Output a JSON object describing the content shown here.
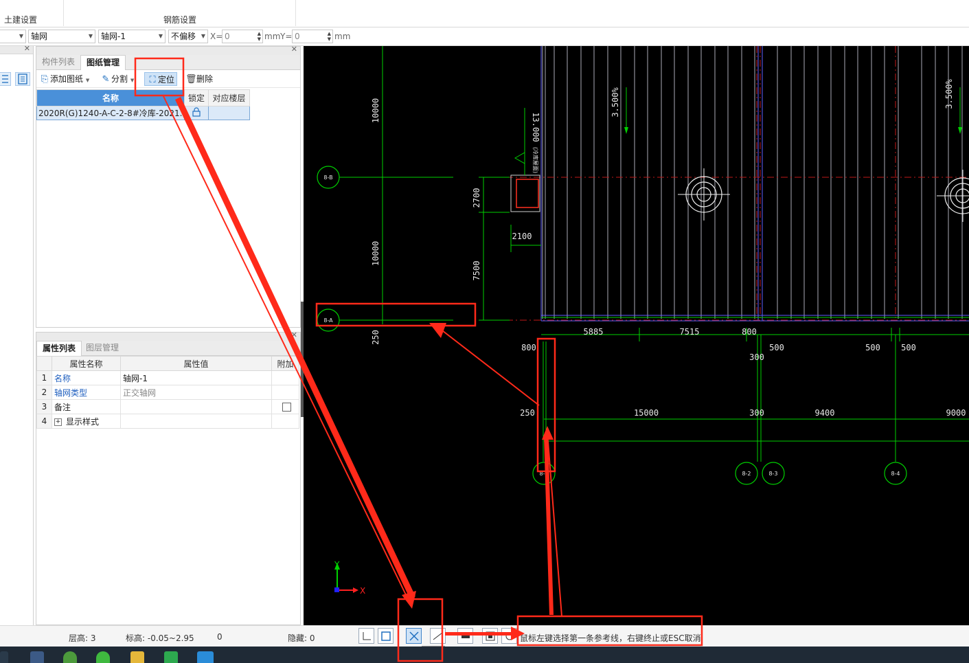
{
  "ribbon": {
    "group_civil": "土建设置",
    "group_rebar": "钢筋设置"
  },
  "toolbar": {
    "combo_axis_type": "轴网",
    "combo_axis_name": "轴网-1",
    "combo_offset": "不偏移",
    "x_label": "X=",
    "x_value": "0",
    "mm_label_1": "mm",
    "y_label": "Y=",
    "y_value": "0",
    "mm_label_2": "mm"
  },
  "drawing_panel": {
    "tabs": [
      "构件列表",
      "图纸管理"
    ],
    "tools": {
      "add": "添加图纸",
      "split": "分割",
      "locate": "定位",
      "delete": "删除"
    },
    "columns": [
      "名称",
      "锁定",
      "对应楼层"
    ],
    "rows": [
      {
        "name": "2020R(G)1240-A-C-2-8#冷库-2021...",
        "lock_icon": "lock-icon",
        "floor": ""
      }
    ]
  },
  "property_panel": {
    "tabs": [
      "属性列表",
      "图层管理"
    ],
    "columns": [
      "属性名称",
      "属性值",
      "附加"
    ],
    "rows": [
      {
        "n": "1",
        "name": "名称",
        "value": "轴网-1",
        "has_check": false
      },
      {
        "n": "2",
        "name": "轴网类型",
        "value": "正交轴网",
        "has_check": false
      },
      {
        "n": "3",
        "name": "备注",
        "value": "",
        "has_check": true
      },
      {
        "n": "4",
        "name": "显示样式",
        "value": "",
        "has_check": false
      }
    ]
  },
  "canvas": {
    "axis_labels": [
      "8-B",
      "8-A",
      "8-1",
      "8-2",
      "8-3",
      "8-4"
    ],
    "dims_vertical": [
      "10000",
      "10000",
      "250",
      "2700",
      "7500",
      "13.000"
    ],
    "dims_horizontal": [
      "2100",
      "5885",
      "7515",
      "800",
      "800",
      "500",
      "500",
      "500",
      "300",
      "300",
      "250",
      "15000",
      "9400",
      "9000"
    ],
    "slope_labels": [
      "3.500%",
      "3.500%"
    ],
    "rotated_note": "(冷库屋面)",
    "ucs_x": "X",
    "ucs_y": "Y"
  },
  "statusbar": {
    "floor_height": "层高:  3",
    "elevation": "标高:  -0.05~2.95",
    "count": "0",
    "hidden": "隐藏:  0",
    "hint": "鼠标左键选择第一条参考线，右键终止或ESC取消",
    "tooltip": "交点"
  },
  "colors": {
    "annotation_red": "#ff2a1a",
    "cad_green": "#00e000",
    "canvas_bg": "#000000"
  },
  "taskbar_icons": [
    "start-menu-icon",
    "pen-app-icon",
    "browser-icon",
    "wechat-icon",
    "folder-icon",
    "wps-icon",
    "text-app-icon"
  ]
}
